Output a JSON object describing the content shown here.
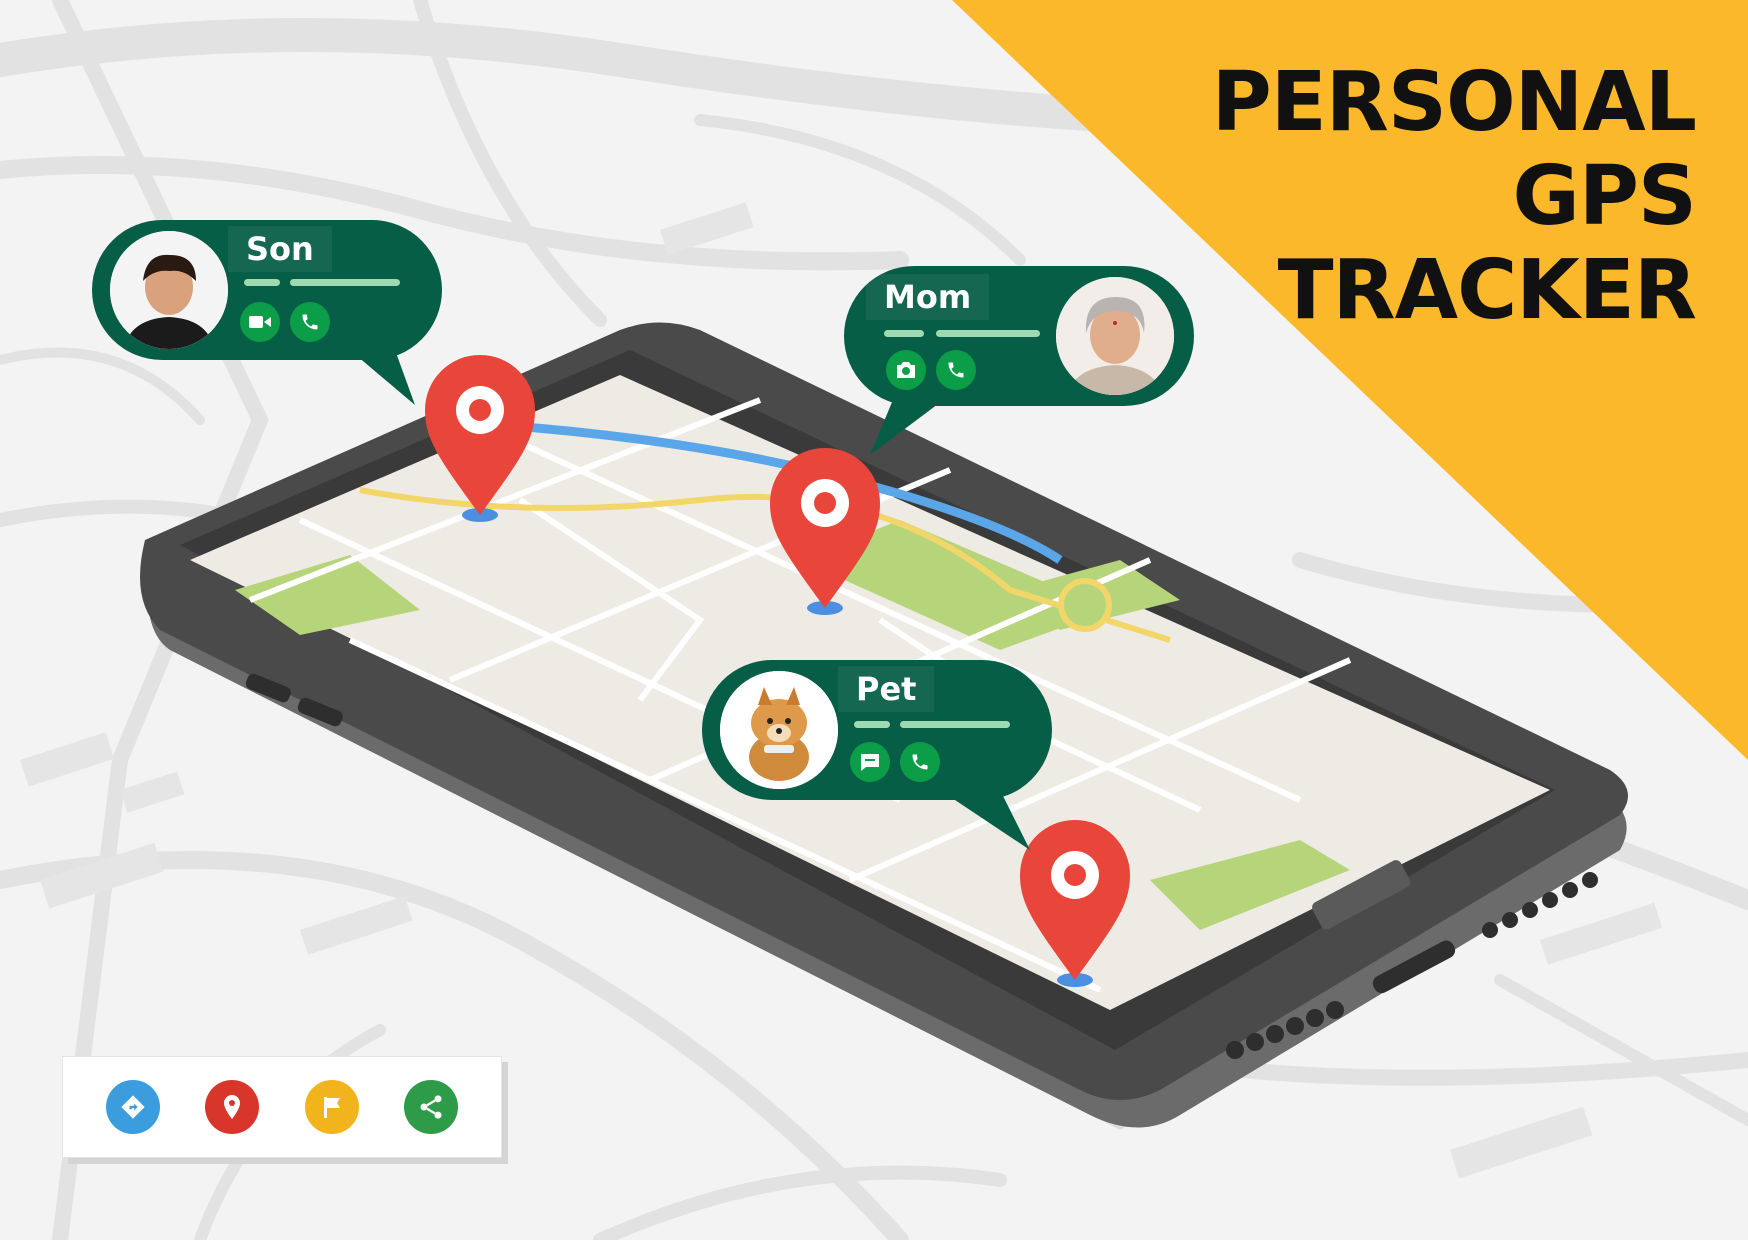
{
  "hero": {
    "title_lines": [
      "PERSONAL",
      "GPS",
      "TRACKER"
    ],
    "accent_color": "#fbb82b",
    "title_color": "#111111"
  },
  "contacts": [
    {
      "name": "Son",
      "actions": [
        "video-icon",
        "phone-icon"
      ]
    },
    {
      "name": "Mom",
      "actions": [
        "camera-icon",
        "phone-icon"
      ]
    },
    {
      "name": "Pet",
      "actions": [
        "message-icon",
        "phone-icon"
      ]
    }
  ],
  "toolbar": {
    "tools": [
      {
        "icon": "directions-icon",
        "color": "#3b9ddd"
      },
      {
        "icon": "location-pin-icon",
        "color": "#d8362b"
      },
      {
        "icon": "flag-icon",
        "color": "#f2b41c"
      },
      {
        "icon": "share-icon",
        "color": "#2e9b48"
      }
    ]
  },
  "colors": {
    "card": "#075e47",
    "action_button": "#0c9d49",
    "map_pin": "#e8463a",
    "route_blue": "#5aa6e8",
    "route_yellow": "#f3d66a",
    "park_green": "#b6d57a"
  }
}
